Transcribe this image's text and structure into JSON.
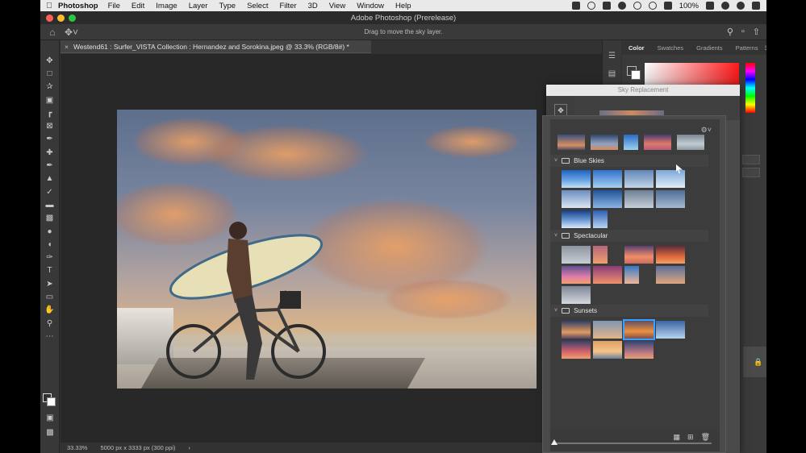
{
  "menubar": {
    "app_name": "Photoshop",
    "items": [
      "File",
      "Edit",
      "Image",
      "Layer",
      "Type",
      "Select",
      "Filter",
      "3D",
      "View",
      "Window",
      "Help"
    ],
    "battery": "100%"
  },
  "window": {
    "title": "Adobe Photoshop (Prerelease)"
  },
  "options_bar": {
    "hint": "Drag to move the sky layer."
  },
  "document": {
    "tab_title": "Westend61 : Surfer_VISTA Collection : Hernandez and Sorokina.jpeg @ 33.3% (RGB/8#) *"
  },
  "status": {
    "zoom": "33.33%",
    "doc_info": "5000 px x 3333 px (300 ppi)"
  },
  "color_panel": {
    "tabs": [
      "Color",
      "Swatches",
      "Gradients",
      "Patterns"
    ],
    "active_tab": "Color"
  },
  "sky_dialog": {
    "title": "Sky Replacement",
    "groups": [
      {
        "name": "Blue Skies"
      },
      {
        "name": "Spectacular"
      },
      {
        "name": "Sunsets"
      }
    ]
  },
  "colors": {
    "accent": "#3aa0ff",
    "panel_bg": "#323232",
    "dialog_bg": "#4a4a4a"
  }
}
